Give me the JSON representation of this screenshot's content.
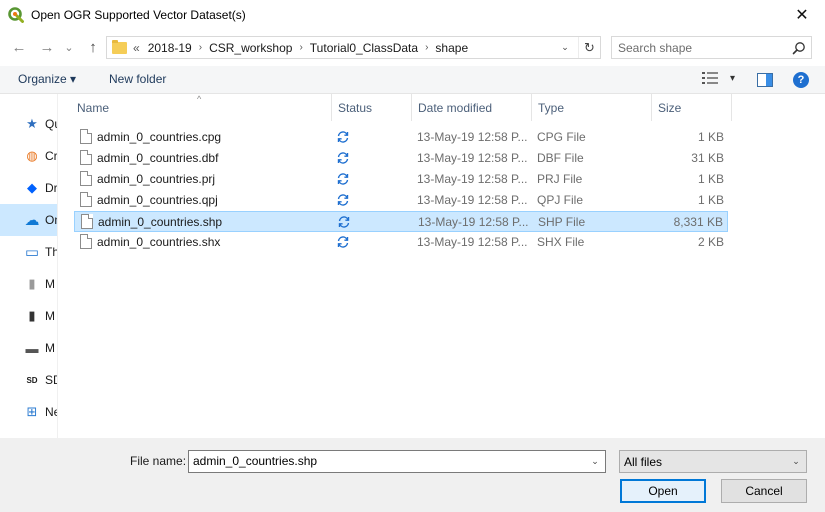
{
  "window": {
    "title": "Open OGR Supported Vector Dataset(s)",
    "close_glyph": "✕"
  },
  "nav": {
    "back_glyph": "←",
    "forward_glyph": "→",
    "recent_glyph": "⌄",
    "up_glyph": "↑",
    "overflow_glyph": "«",
    "breadcrumbs": [
      "2018-19",
      "CSR_workshop",
      "Tutorial0_ClassData",
      "shape"
    ],
    "breadcrumb_separator": "›",
    "dropdown_glyph": "⌄",
    "refresh_glyph": "↻",
    "search_placeholder": "Search shape"
  },
  "toolbar": {
    "organize_label": "Organize ▾",
    "new_folder_label": "New folder",
    "view_glyph": "▾",
    "help_glyph": "?"
  },
  "sidebar": {
    "items": [
      {
        "label": "Qu",
        "icon": "star-icon",
        "glyph": "★",
        "color": "#2f6fbf"
      },
      {
        "label": "Cr",
        "icon": "creative-cloud-icon",
        "glyph": "◍",
        "color": "#e8731b"
      },
      {
        "label": "Dr",
        "icon": "dropbox-icon",
        "glyph": "◆",
        "color": "#0061fe"
      },
      {
        "label": "On",
        "icon": "onedrive-icon",
        "glyph": "☁",
        "color": "#0f78d4"
      },
      {
        "label": "Th",
        "icon": "this-pc-icon",
        "glyph": "▭",
        "color": "#2b7bd1"
      },
      {
        "label": "M",
        "icon": "drive-icon",
        "glyph": "▮",
        "color": "#9a9a9a"
      },
      {
        "label": "M",
        "icon": "drive-icon",
        "glyph": "▮",
        "color": "#333333"
      },
      {
        "label": "M",
        "icon": "drive-icon",
        "glyph": "▬",
        "color": "#555555"
      },
      {
        "label": "SD",
        "icon": "sd-card-icon",
        "glyph": "SD",
        "color": "#1a1a1a"
      },
      {
        "label": "Ne",
        "icon": "network-icon",
        "glyph": "⊞",
        "color": "#2b7bd1"
      }
    ]
  },
  "columns": {
    "name": "Name",
    "status": "Status",
    "date_modified": "Date modified",
    "type": "Type",
    "size": "Size",
    "sort_glyph": "^"
  },
  "files": [
    {
      "name": "admin_0_countries.cpg",
      "date": "13-May-19 12:58 P...",
      "type": "CPG File",
      "size": "1 KB"
    },
    {
      "name": "admin_0_countries.dbf",
      "date": "13-May-19 12:58 P...",
      "type": "DBF File",
      "size": "31 KB"
    },
    {
      "name": "admin_0_countries.prj",
      "date": "13-May-19 12:58 P...",
      "type": "PRJ File",
      "size": "1 KB"
    },
    {
      "name": "admin_0_countries.qpj",
      "date": "13-May-19 12:58 P...",
      "type": "QPJ File",
      "size": "1 KB"
    },
    {
      "name": "admin_0_countries.shp",
      "date": "13-May-19 12:58 P...",
      "type": "SHP File",
      "size": "8,331 KB"
    },
    {
      "name": "admin_0_countries.shx",
      "date": "13-May-19 12:58 P...",
      "type": "SHX File",
      "size": "2 KB"
    }
  ],
  "footer": {
    "file_name_label": "File name:",
    "file_name_value": "admin_0_countries.shp",
    "filter_value": "All files",
    "open_label": "Open",
    "cancel_label": "Cancel",
    "dropdown_glyph": "⌄"
  },
  "colors": {
    "selection": "#cce8ff",
    "selection_border": "#99d1ff",
    "accent": "#0078d7",
    "sync_icon": "#1e6fd0"
  }
}
